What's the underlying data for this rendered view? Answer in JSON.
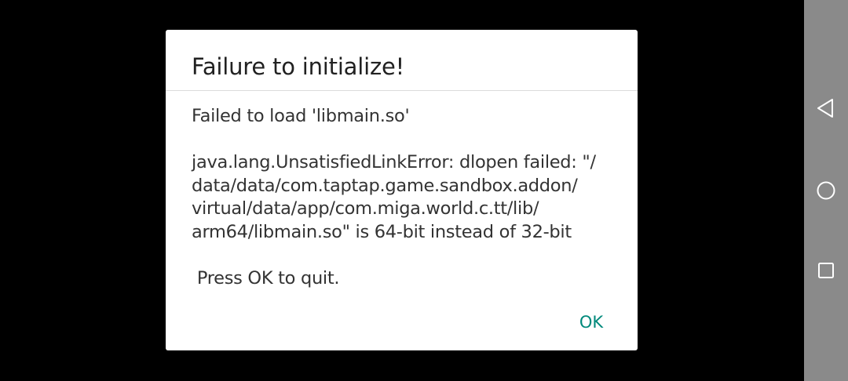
{
  "dialog": {
    "title": "Failure to initialize!",
    "message": "Failed to load 'libmain.so'\n\njava.lang.UnsatisfiedLinkError: dlopen failed: \"/\ndata/data/com.taptap.game.sandbox.addon/\nvirtual/data/app/com.miga.world.c.tt/lib/\narm64/libmain.so\" is 64-bit instead of 32-bit\n\n Press OK to quit.",
    "ok_label": "OK"
  },
  "navigation": {
    "back_icon": "triangle-back-icon",
    "home_icon": "circle-home-icon",
    "recent_icon": "square-recents-icon"
  },
  "colors": {
    "background": "#000000",
    "dialog_background": "#ffffff",
    "accent": "#00897b",
    "nav_bar": "#8a8a8a"
  }
}
